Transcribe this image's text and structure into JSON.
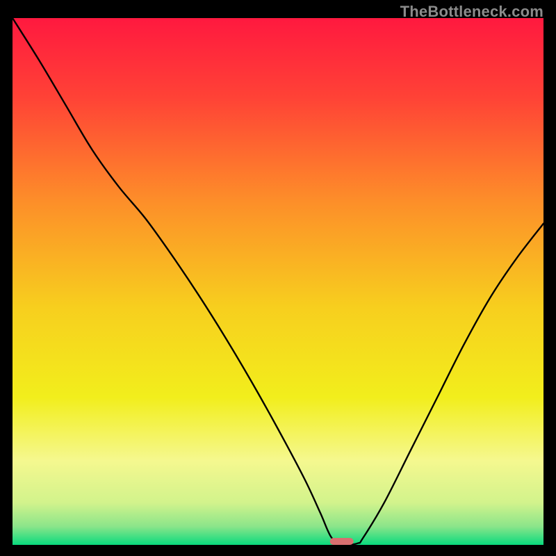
{
  "watermark": "TheBottleneck.com",
  "chart_data": {
    "type": "line",
    "title": "",
    "xlabel": "",
    "ylabel": "",
    "xlim": [
      0,
      100
    ],
    "ylim": [
      0,
      100
    ],
    "grid": false,
    "legend": false,
    "marker": {
      "x": 62,
      "y": 0,
      "color": "#d86f70"
    },
    "series": [
      {
        "name": "bottleneck-curve",
        "x": [
          0,
          5,
          10,
          15,
          20,
          25,
          30,
          35,
          40,
          45,
          50,
          55,
          58,
          60,
          62,
          65,
          66,
          70,
          75,
          80,
          85,
          90,
          95,
          100
        ],
        "y": [
          100,
          92,
          83.5,
          75,
          68,
          62,
          55,
          47.5,
          39.5,
          31,
          22,
          12.5,
          6,
          1.5,
          0,
          0.3,
          1.3,
          8,
          18,
          28,
          38,
          47,
          54.5,
          61
        ]
      }
    ],
    "background_gradient": {
      "stops": [
        {
          "pos": 0.0,
          "color": "#ff193f"
        },
        {
          "pos": 0.15,
          "color": "#ff4236"
        },
        {
          "pos": 0.35,
          "color": "#fd8f29"
        },
        {
          "pos": 0.55,
          "color": "#f7cf1e"
        },
        {
          "pos": 0.72,
          "color": "#f2ee1c"
        },
        {
          "pos": 0.84,
          "color": "#f5f88f"
        },
        {
          "pos": 0.92,
          "color": "#d2f38c"
        },
        {
          "pos": 0.965,
          "color": "#8be58a"
        },
        {
          "pos": 1.0,
          "color": "#09da7e"
        }
      ]
    }
  }
}
